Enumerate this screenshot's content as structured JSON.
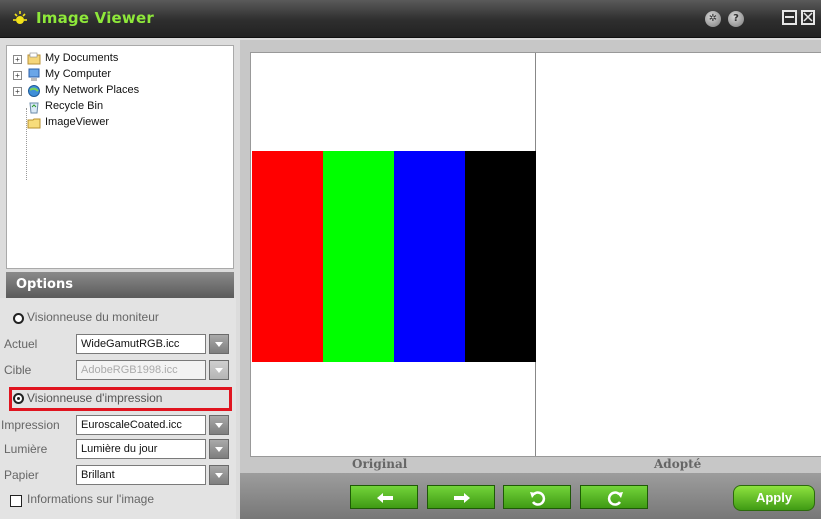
{
  "app": {
    "title": "Image Viewer"
  },
  "titlebar": {
    "icons": [
      "settings-icon",
      "help-icon",
      "minimize-icon",
      "close-icon"
    ],
    "settings_glyph": "✲",
    "help_glyph": "?"
  },
  "tree": {
    "items": [
      {
        "label": "My Documents",
        "icon": "documents-folder-icon",
        "expander": "+"
      },
      {
        "label": "My Computer",
        "icon": "computer-icon",
        "expander": "+"
      },
      {
        "label": "My Network Places",
        "icon": "network-places-icon",
        "expander": "+"
      },
      {
        "label": "Recycle Bin",
        "icon": "recycle-bin-icon"
      },
      {
        "label": "ImageViewer",
        "icon": "folder-icon"
      }
    ]
  },
  "options": {
    "header": "Options",
    "monitor_viewer_label": "Visionneuse du moniteur",
    "actuel_label": "Actuel",
    "actuel_value": "WideGamutRGB.icc",
    "cible_label": "Cible",
    "cible_value": "AdobeRGB1998.icc",
    "print_viewer_label": "Visionneuse d'impression",
    "impression_label": "Impression",
    "impression_value": "EuroscaleCoated.icc",
    "lumiere_label": "Lumière",
    "lumiere_value": "Lumière du jour",
    "papier_label": "Papier",
    "papier_value": "Brillant",
    "image_info_label": "Informations sur l'image",
    "selected_viewer": "print"
  },
  "main": {
    "original_label": "Original",
    "adopted_label": "Adopté",
    "swatches": [
      "#ff0000",
      "#00ff00",
      "#0000ff",
      "#000000"
    ]
  },
  "toolbar": {
    "buttons": [
      "arrow-left-icon",
      "arrow-right-icon",
      "rotate-ccw-icon",
      "rotate-cw-icon"
    ],
    "apply_label": "Apply"
  },
  "colors": {
    "accent": "#8ee83a",
    "highlight": "#e0141f",
    "button_green": "#5bbf2a"
  }
}
